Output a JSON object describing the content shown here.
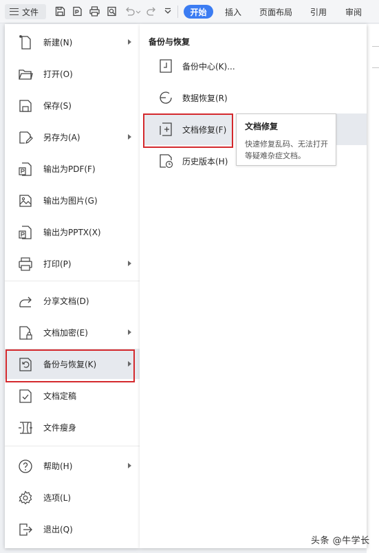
{
  "toolbar": {
    "file_label": "文件",
    "tabs": [
      "开始",
      "插入",
      "页面布局",
      "引用",
      "审阅"
    ],
    "active_tab": "开始",
    "icons": [
      "save-icon",
      "export-pdf-icon",
      "print-icon",
      "print-preview-icon",
      "undo-icon",
      "redo-icon",
      "more-icon"
    ]
  },
  "file_menu": {
    "items": [
      {
        "label": "新建(N)",
        "icon": "new-file-icon",
        "submenu": true
      },
      {
        "label": "打开(O)",
        "icon": "folder-open-icon",
        "submenu": false
      },
      {
        "label": "保存(S)",
        "icon": "save-icon",
        "submenu": false
      },
      {
        "label": "另存为(A)",
        "icon": "save-as-icon",
        "submenu": true
      },
      {
        "label": "输出为PDF(F)",
        "icon": "pdf-icon",
        "submenu": false
      },
      {
        "label": "输出为图片(G)",
        "icon": "image-icon",
        "submenu": false
      },
      {
        "label": "输出为PPTX(X)",
        "icon": "pptx-icon",
        "submenu": false
      },
      {
        "label": "打印(P)",
        "icon": "print-icon",
        "submenu": true
      },
      {
        "label": "分享文档(D)",
        "icon": "share-icon",
        "submenu": false
      },
      {
        "label": "文档加密(E)",
        "icon": "encrypt-icon",
        "submenu": true
      },
      {
        "label": "备份与恢复(K)",
        "icon": "backup-icon",
        "submenu": true,
        "selected": true
      },
      {
        "label": "文档定稿",
        "icon": "finalize-icon",
        "submenu": false
      },
      {
        "label": "文件瘦身",
        "icon": "slim-icon",
        "submenu": false
      },
      {
        "label": "帮助(H)",
        "icon": "help-icon",
        "submenu": true
      },
      {
        "label": "选项(L)",
        "icon": "gear-icon",
        "submenu": false
      },
      {
        "label": "退出(Q)",
        "icon": "exit-icon",
        "submenu": false
      }
    ]
  },
  "backup_menu": {
    "title": "备份与恢复",
    "items": [
      {
        "label": "备份中心(K)...",
        "icon": "backup-center-icon"
      },
      {
        "label": "数据恢复(R)",
        "icon": "data-recovery-icon"
      },
      {
        "label": "文档修复(F)",
        "icon": "doc-repair-icon",
        "hovered": true
      },
      {
        "label": "历史版本(H)",
        "icon": "history-version-icon"
      }
    ]
  },
  "tooltip": {
    "title": "文档修复",
    "body": "快速修复乱码、无法打开等疑难杂症文档。"
  },
  "watermark": "头条 @牛学长",
  "colors": {
    "accent": "#3b7cf2",
    "highlight_border": "#d4282c",
    "hover_bg": "#e6e9ee"
  }
}
